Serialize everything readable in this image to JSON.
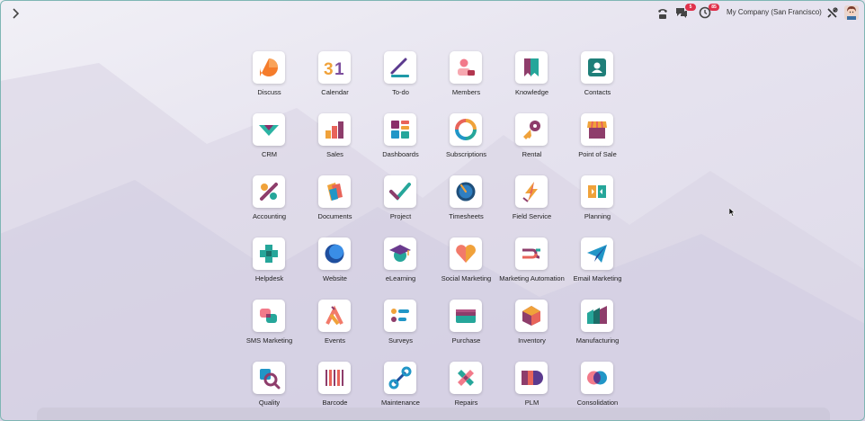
{
  "topbar": {
    "company": "My Company (San Francisco)",
    "chat_badge": "5",
    "activity_badge": "85"
  },
  "apps": [
    {
      "label": "Discuss",
      "icon": "discuss-icon"
    },
    {
      "label": "Calendar",
      "icon": "calendar-icon"
    },
    {
      "label": "To-do",
      "icon": "todo-icon"
    },
    {
      "label": "Members",
      "icon": "members-icon"
    },
    {
      "label": "Knowledge",
      "icon": "knowledge-icon"
    },
    {
      "label": "Contacts",
      "icon": "contacts-icon"
    },
    {
      "label": "CRM",
      "icon": "crm-icon"
    },
    {
      "label": "Sales",
      "icon": "sales-icon"
    },
    {
      "label": "Dashboards",
      "icon": "dashboards-icon"
    },
    {
      "label": "Subscriptions",
      "icon": "subscriptions-icon"
    },
    {
      "label": "Rental",
      "icon": "rental-icon"
    },
    {
      "label": "Point of Sale",
      "icon": "point-of-sale-icon"
    },
    {
      "label": "Accounting",
      "icon": "accounting-icon"
    },
    {
      "label": "Documents",
      "icon": "documents-icon"
    },
    {
      "label": "Project",
      "icon": "project-icon"
    },
    {
      "label": "Timesheets",
      "icon": "timesheets-icon"
    },
    {
      "label": "Field Service",
      "icon": "field-service-icon"
    },
    {
      "label": "Planning",
      "icon": "planning-icon"
    },
    {
      "label": "Helpdesk",
      "icon": "helpdesk-icon"
    },
    {
      "label": "Website",
      "icon": "website-icon"
    },
    {
      "label": "eLearning",
      "icon": "elearning-icon"
    },
    {
      "label": "Social Marketing",
      "icon": "social-marketing-icon"
    },
    {
      "label": "Marketing Automation",
      "icon": "marketing-automation-icon"
    },
    {
      "label": "Email Marketing",
      "icon": "email-marketing-icon"
    },
    {
      "label": "SMS Marketing",
      "icon": "sms-marketing-icon"
    },
    {
      "label": "Events",
      "icon": "events-icon"
    },
    {
      "label": "Surveys",
      "icon": "surveys-icon"
    },
    {
      "label": "Purchase",
      "icon": "purchase-icon"
    },
    {
      "label": "Inventory",
      "icon": "inventory-icon"
    },
    {
      "label": "Manufacturing",
      "icon": "manufacturing-icon"
    },
    {
      "label": "Quality",
      "icon": "quality-icon"
    },
    {
      "label": "Barcode",
      "icon": "barcode-icon"
    },
    {
      "label": "Maintenance",
      "icon": "maintenance-icon"
    },
    {
      "label": "Repairs",
      "icon": "repairs-icon"
    },
    {
      "label": "PLM",
      "icon": "plm-icon"
    },
    {
      "label": "Consolidation",
      "icon": "consolidation-icon"
    }
  ]
}
